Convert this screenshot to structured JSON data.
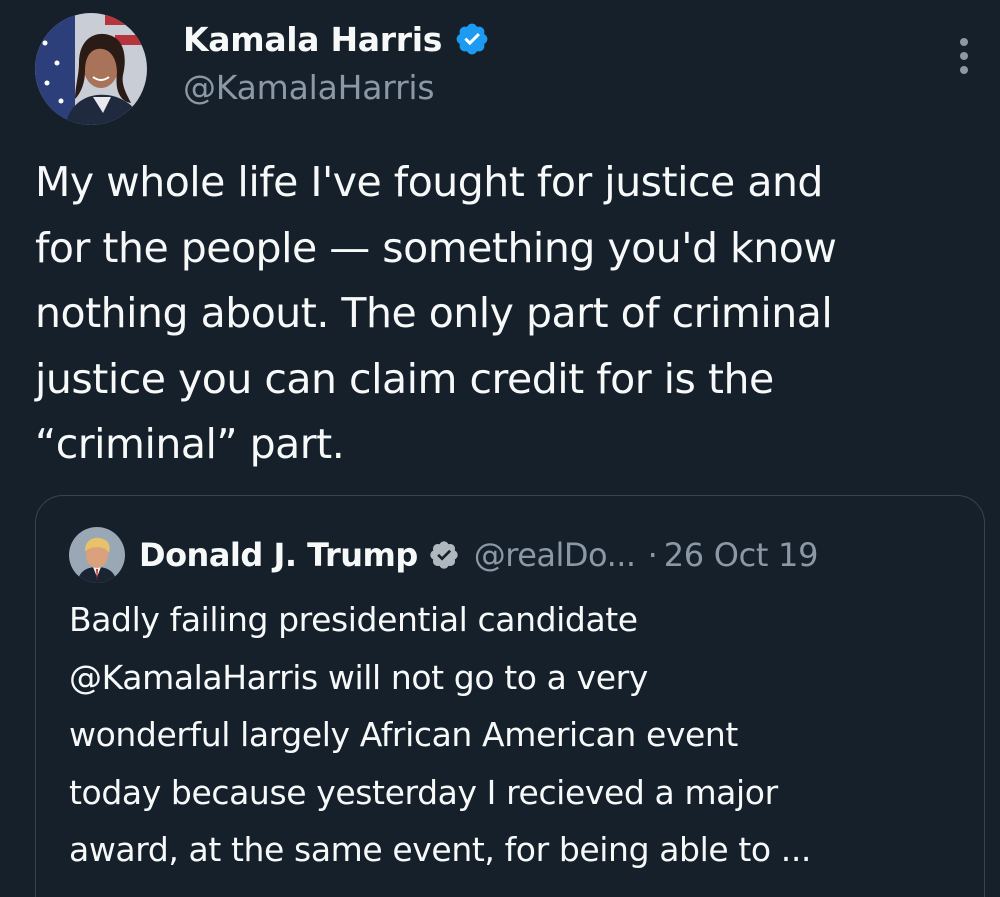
{
  "tweet": {
    "author": {
      "display_name": "Kamala Harris",
      "handle": "@KamalaHarris",
      "verified": true,
      "avatar_icon": "profile-photo"
    },
    "menu_icon": "more-vertical-icon",
    "text": "My whole life I've fought for justice and\nfor the people — something you'd know\nnothing about. The only part of criminal\njustice you can claim credit for is the\n“criminal” part."
  },
  "quoted_tweet": {
    "author": {
      "display_name": "Donald J. Trump",
      "handle": "@realDo...",
      "verified": true,
      "avatar_icon": "profile-photo"
    },
    "separator": "·",
    "date": "26 Oct 19",
    "text": "Badly failing presidential candidate\n@KamalaHarris will not go to a very\nwonderful largely African American event\ntoday because yesterday I recieved a major\naward, at the same event, for being able to ..."
  },
  "colors": {
    "background": "#15202b",
    "text_primary": "#f7f9f9",
    "text_secondary": "#8b98a5",
    "verified_blue": "#1d9bf0",
    "verified_gold_grey": "#b0b8bf",
    "border": "#38444d"
  }
}
